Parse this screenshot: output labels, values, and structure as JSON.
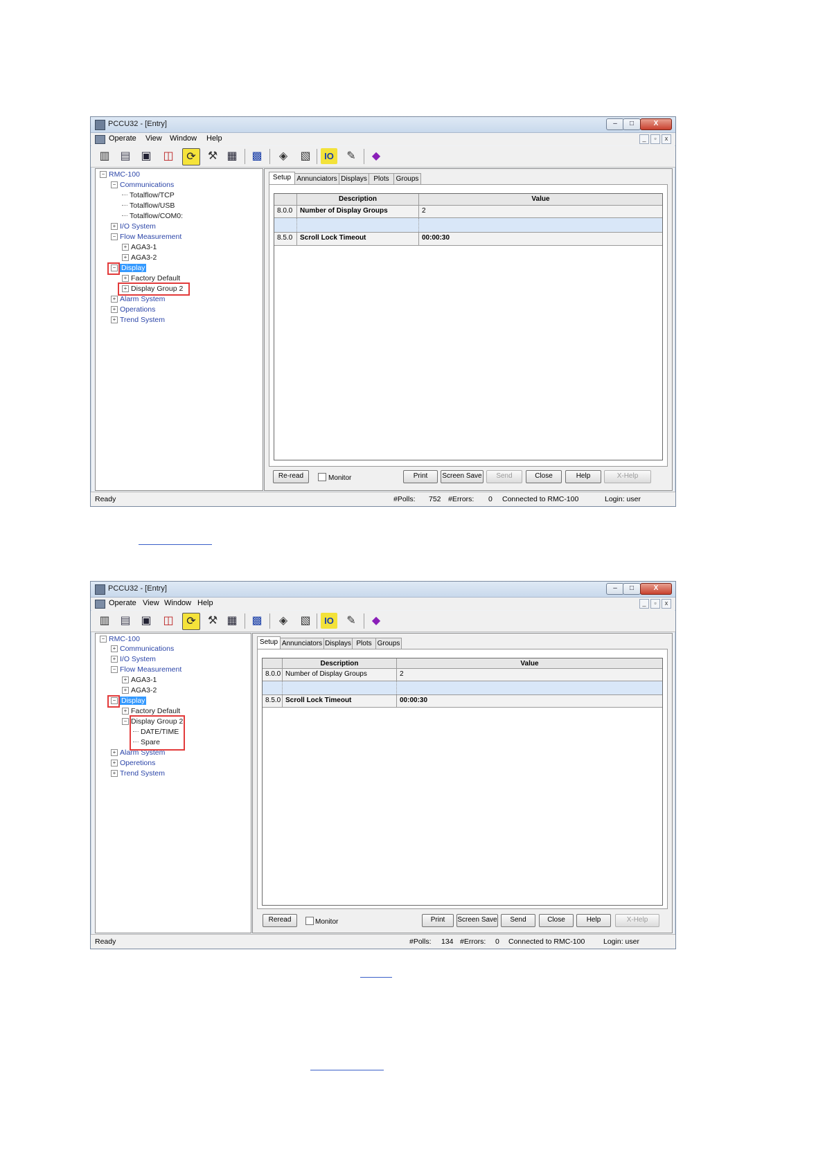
{
  "window": {
    "title": "PCCU32 - [Entry]",
    "min_label": "–",
    "max_label": "□",
    "close_label": "X",
    "menu": [
      "Operate",
      "View",
      "Window",
      "Help"
    ],
    "mdi": [
      "_",
      "▫",
      "x"
    ]
  },
  "tree1": {
    "root": "RMC-100",
    "communications": "Communications",
    "tcp": "Totalflow/TCP",
    "usb": "Totalflow/USB",
    "com0": "Totalflow/COM0:",
    "io": "I/O System",
    "flow": "Flow Measurement",
    "aga1": "AGA3-1",
    "aga2": "AGA3-2",
    "display": "Display",
    "factory": "Factory Default",
    "group2": "Display Group 2",
    "alarm": "Alarm System",
    "operations": "Operations",
    "trend": "Trend System"
  },
  "tree2": {
    "root": "RMC-100",
    "communications": "Communications",
    "io": "I/O System",
    "flow": "Flow Measurement",
    "aga1": "AGA3-1",
    "aga2": "AGA3-2",
    "display": "Display",
    "factory": "Factory Default",
    "group2": "Display Group 2",
    "datetime": "DATE/TIME",
    "spare": "Spare",
    "alarm": "Alarm System",
    "operations": "Operetions",
    "trend": "Trend System"
  },
  "tabs": [
    "Setup",
    "Annunciators",
    "Displays",
    "Plots",
    "Groups"
  ],
  "grid": {
    "headers": [
      "Description",
      "Value"
    ],
    "rows": [
      {
        "id": "8.0.0",
        "desc": "Number of Display Groups",
        "value": "2"
      },
      {
        "id": "",
        "desc": "",
        "value": ""
      },
      {
        "id": "8.5.0",
        "desc": "Scroll Lock Timeout",
        "value": "00:00:30"
      }
    ]
  },
  "buttons1": {
    "reread": "Re-read",
    "monitor": "Monitor",
    "print": "Print",
    "screen_save": "Screen Save",
    "send": "Send",
    "close": "Close",
    "help": "Help",
    "xhelp": "X-Help"
  },
  "buttons2": {
    "reread": "Reread",
    "monitor": "Monitor",
    "print": "Print",
    "screen_save": "Screen Save",
    "send": "Send",
    "close": "Close",
    "help": "Help",
    "xhelp": "X-Help"
  },
  "status1": {
    "ready": "Ready",
    "polls_label": "#Polls:",
    "polls_value": "752",
    "errors_label": "#Errors:",
    "errors_value": "0",
    "connected": "Connected to RMC-100",
    "login": "Login: user"
  },
  "status2": {
    "ready": "Ready",
    "polls_label": "#Polls:",
    "polls_value": "134",
    "errors_label": "#Errors:",
    "errors_value": "0",
    "connected": "Connected to RMC-100",
    "login": "Login: user"
  },
  "toolbar_icons": [
    "entry-icon",
    "collect-icon",
    "folder-icon",
    "refresh-icon",
    "tools-icon",
    "setup-icon",
    "modbus-icon",
    "cone-icon",
    "archive-icon",
    "io-icon",
    "setup-tool-icon",
    "book-icon"
  ],
  "colors": {
    "accent": "#3399ff",
    "highlight_box": "#e23a3a",
    "tree_text": "#2b45a8"
  }
}
